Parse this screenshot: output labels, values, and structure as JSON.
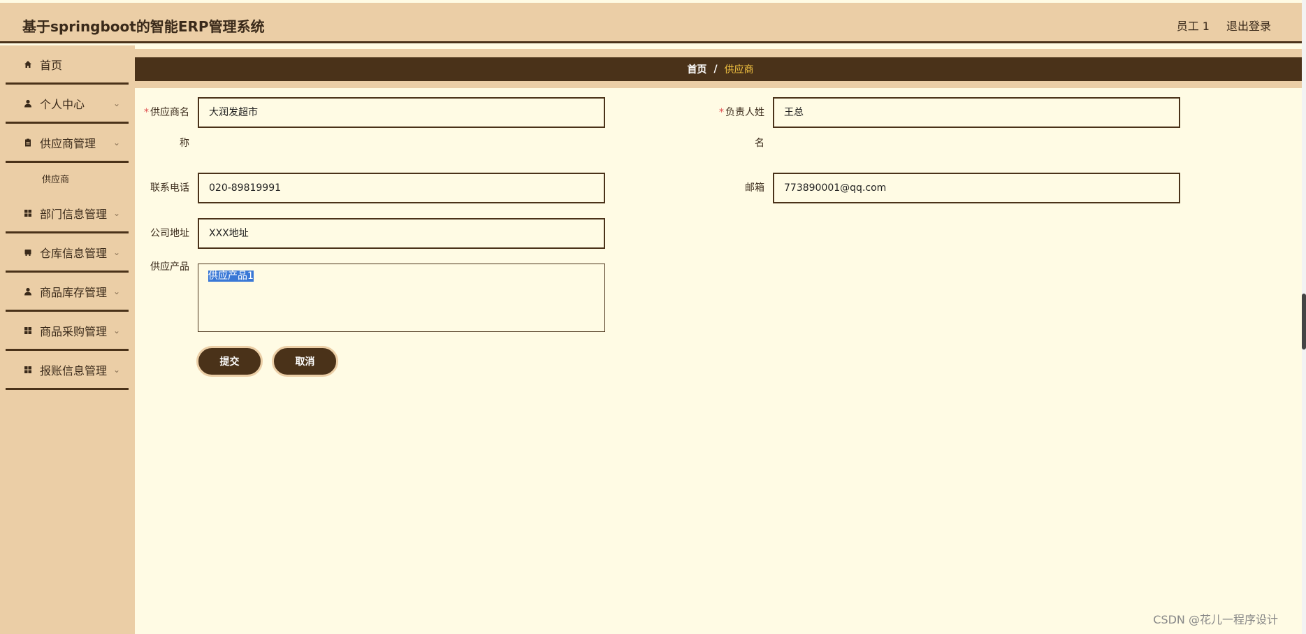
{
  "header": {
    "title": "基于springboot的智能ERP管理系统",
    "user": "员工 1",
    "logout": "退出登录"
  },
  "sidebar": {
    "items": [
      {
        "label": "首页",
        "icon": "home-icon"
      },
      {
        "label": "个人中心",
        "icon": "user-icon"
      },
      {
        "label": "供应商管理",
        "icon": "clipboard-icon",
        "sub": [
          "供应商"
        ]
      },
      {
        "label": "部门信息管理",
        "icon": "grid-icon"
      },
      {
        "label": "仓库信息管理",
        "icon": "box-icon"
      },
      {
        "label": "商品库存管理",
        "icon": "user-icon"
      },
      {
        "label": "商品采购管理",
        "icon": "grid-icon"
      },
      {
        "label": "报账信息管理",
        "icon": "grid-icon"
      }
    ]
  },
  "breadcrumb": {
    "home": "首页",
    "sep": "/",
    "current": "供应商"
  },
  "form": {
    "supplier_name": {
      "label_line1": "供应商名",
      "label_line2": "称",
      "value": "大润发超市"
    },
    "contact_person": {
      "label_line1": "负责人姓",
      "label_line2": "名",
      "value": "王总"
    },
    "phone": {
      "label": "联系电话",
      "value": "020-89819991"
    },
    "email": {
      "label": "邮箱",
      "value": "773890001@qq.com"
    },
    "address": {
      "label": "公司地址",
      "value": "XXX地址"
    },
    "products": {
      "label": "供应产品",
      "value": "供应产品1"
    },
    "submit": "提交",
    "cancel": "取消"
  },
  "watermark": "CSDN @花儿一程序设计"
}
